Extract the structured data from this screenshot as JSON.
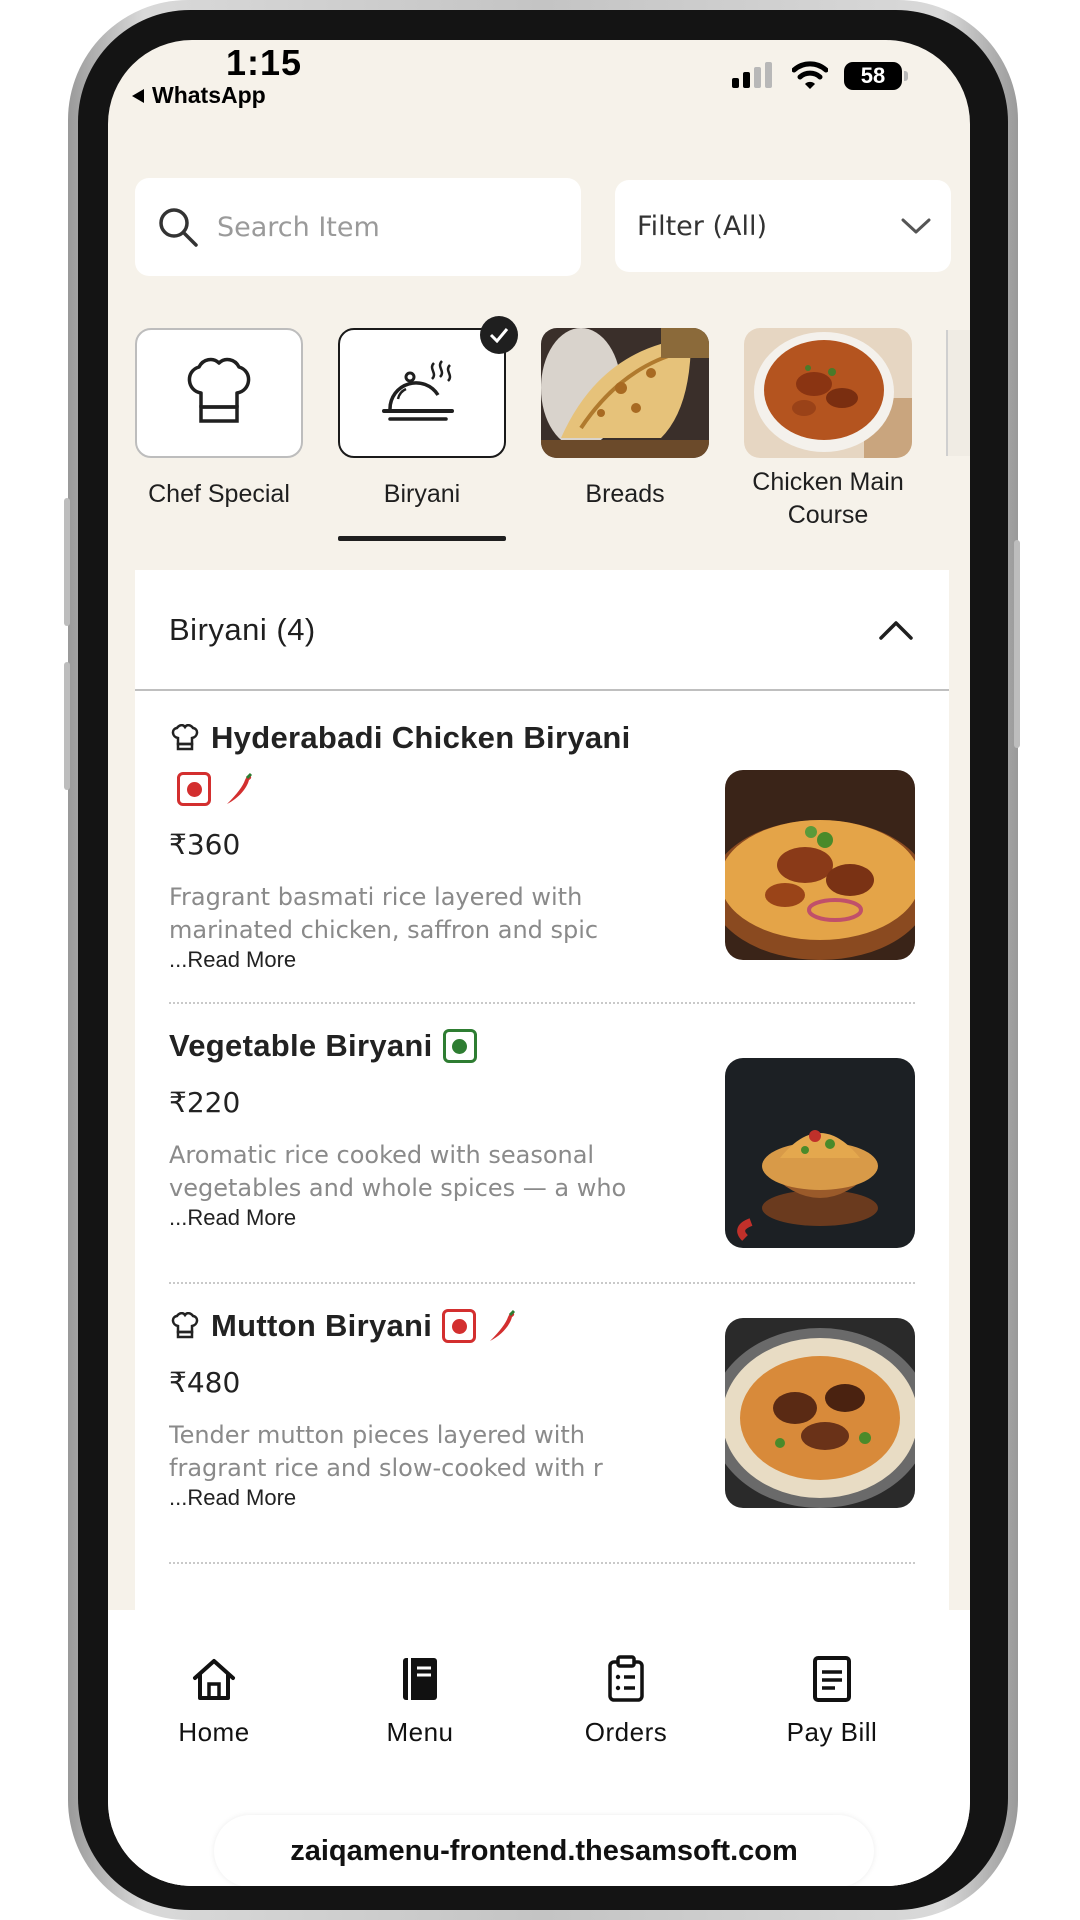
{
  "status_bar": {
    "time": "1:15",
    "back_app": "WhatsApp",
    "battery": "58"
  },
  "search": {
    "placeholder": "Search Item"
  },
  "filter": {
    "label": "Filter (All)"
  },
  "categories": [
    {
      "label": "Chef Special",
      "icon": "chef-hat-icon"
    },
    {
      "label": "Biryani",
      "icon": "cloche-icon",
      "selected": true
    },
    {
      "label": "Breads",
      "icon": "breads-photo"
    },
    {
      "label": "Chicken Main Course",
      "icon": "chicken-curry-photo"
    }
  ],
  "section": {
    "title": "Biryani (4)"
  },
  "items": [
    {
      "name": "Hyderabadi Chicken Biryani",
      "price": "₹360",
      "description": "Fragrant basmati rice layered with marinated chicken, saffron and spic",
      "read_more": "...Read More",
      "chef_special": true,
      "type": "non-veg",
      "spicy": true
    },
    {
      "name": "Vegetable Biryani",
      "price": "₹220",
      "description": "Aromatic rice cooked with seasonal vegetables and whole spices — a who",
      "read_more": "...Read More",
      "chef_special": false,
      "type": "veg",
      "spicy": false
    },
    {
      "name": "Mutton Biryani",
      "price": "₹480",
      "description": "Tender mutton pieces layered with fragrant rice and slow-cooked with r",
      "read_more": "...Read More",
      "chef_special": true,
      "type": "non-veg",
      "spicy": true
    }
  ],
  "bottom_nav": [
    {
      "label": "Home",
      "icon": "home-icon"
    },
    {
      "label": "Menu",
      "icon": "menu-book-icon"
    },
    {
      "label": "Orders",
      "icon": "clipboard-icon"
    },
    {
      "label": "Pay Bill",
      "icon": "bill-icon"
    }
  ],
  "url": "zaiqamenu-frontend.thesamsoft.com",
  "colors": {
    "background": "#f6f2ea",
    "nonveg": "#d32f2f",
    "veg": "#2e7d32",
    "text": "#1f1f1f"
  }
}
